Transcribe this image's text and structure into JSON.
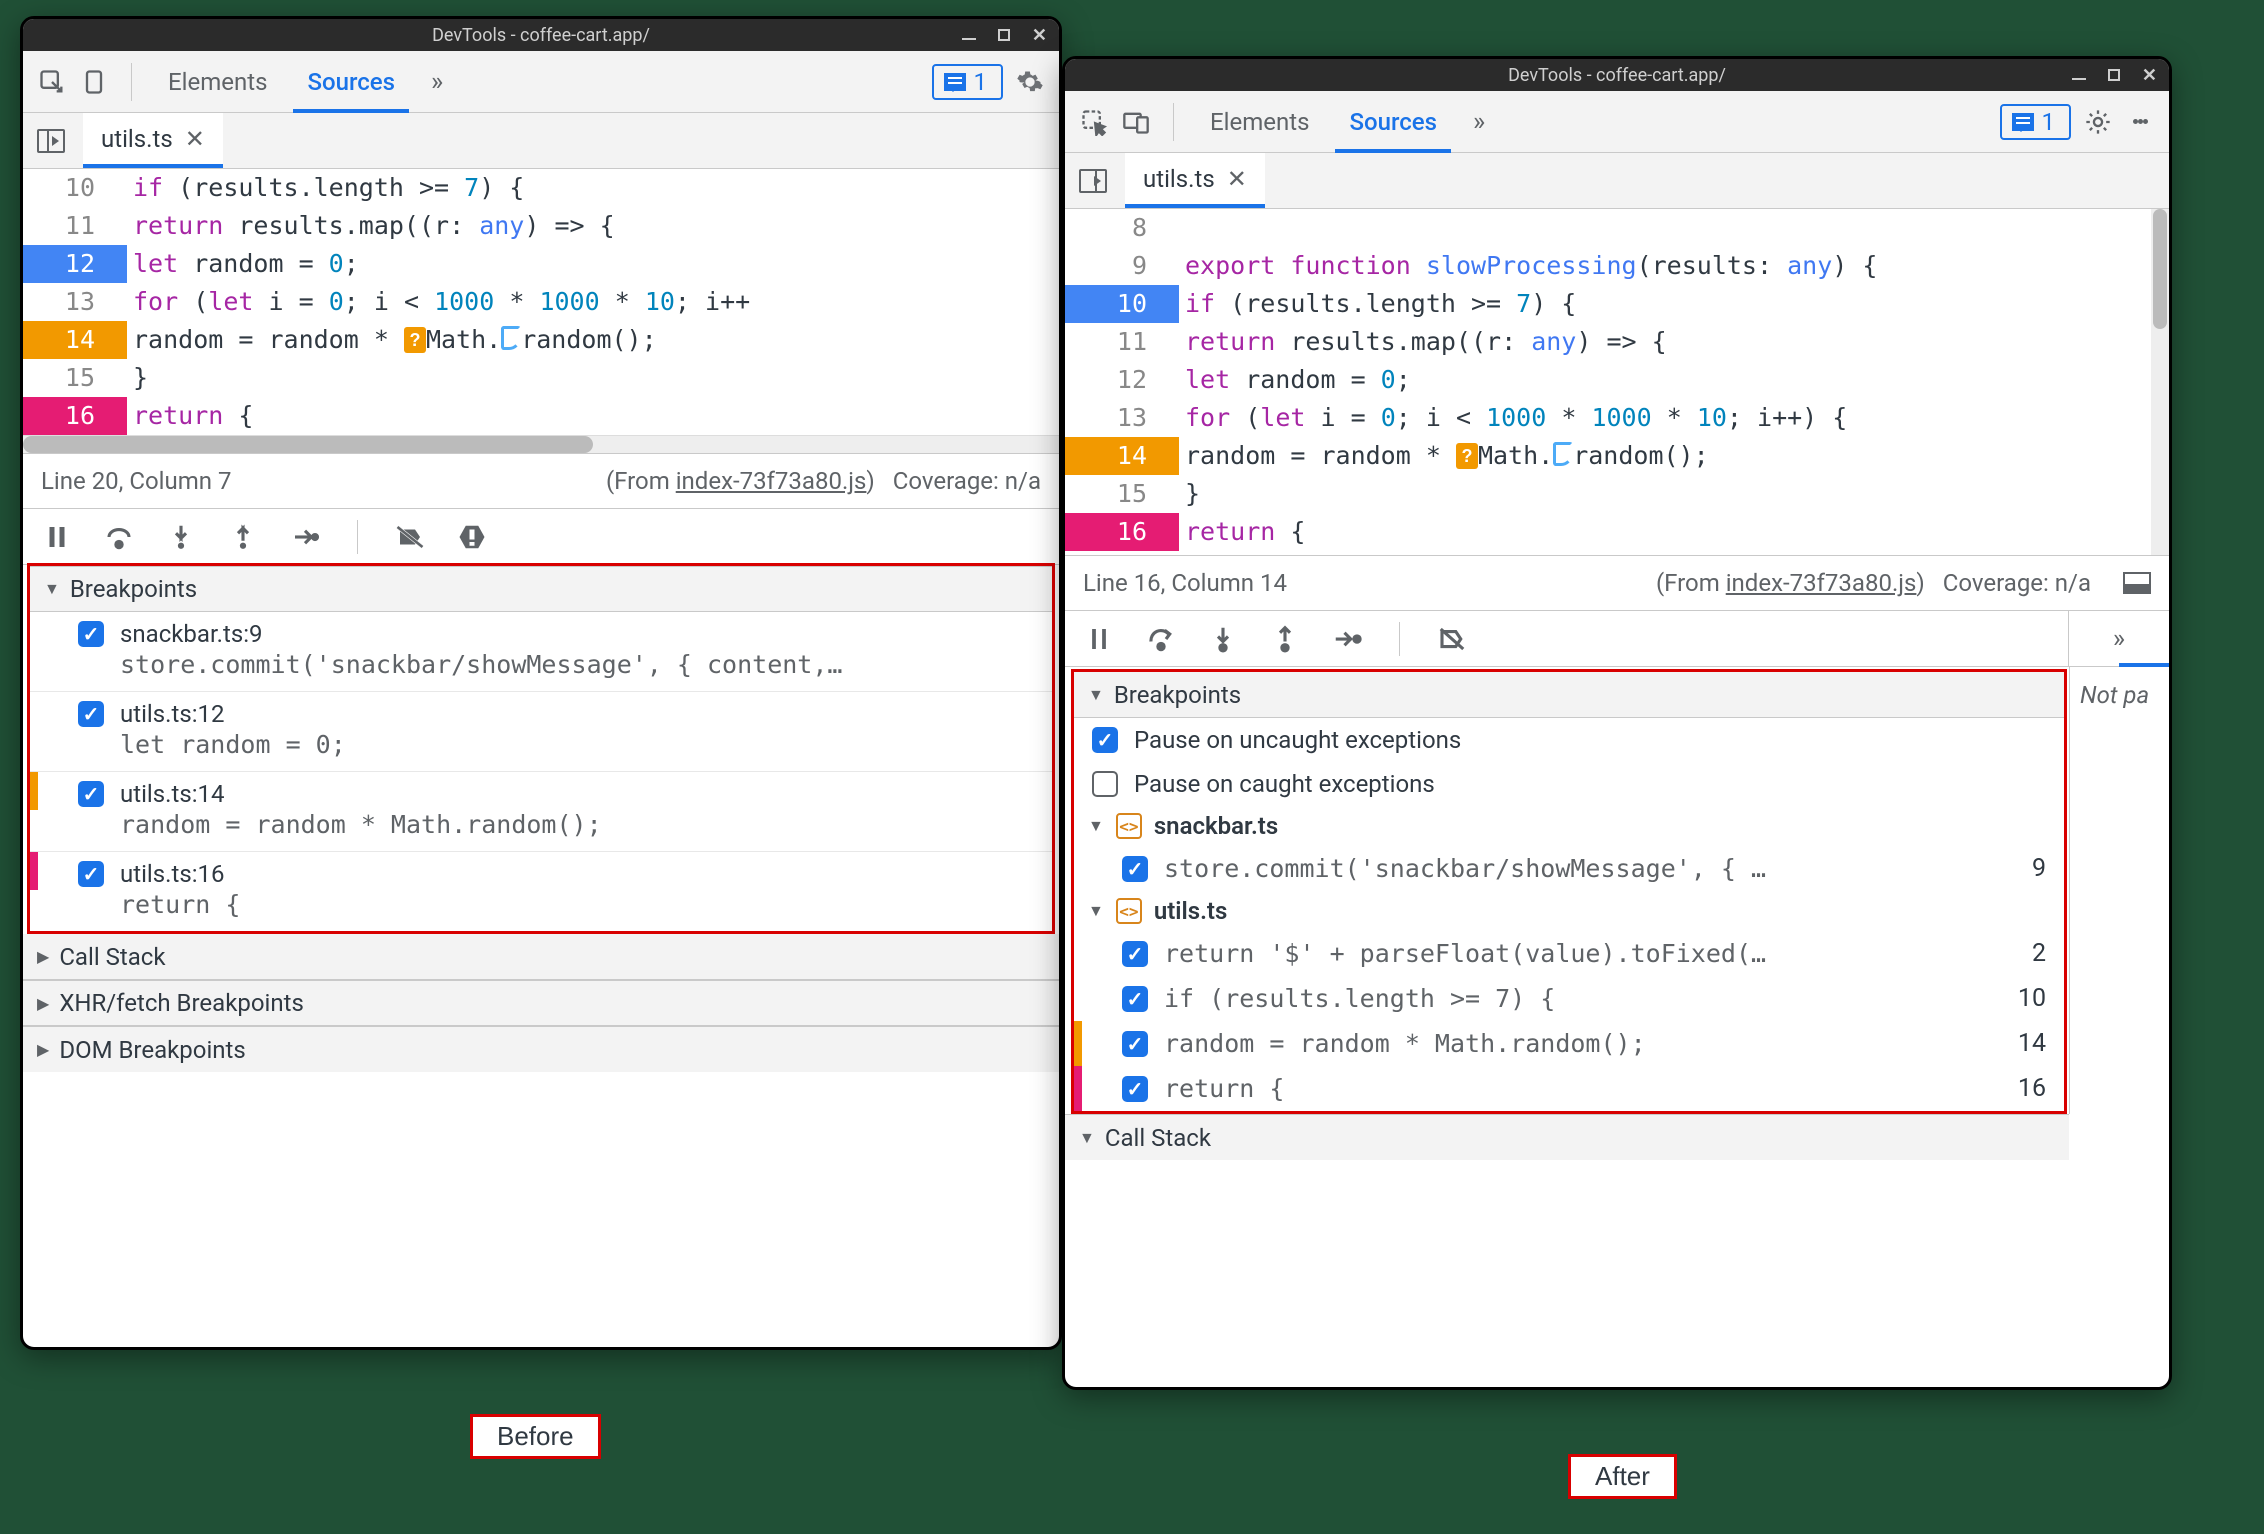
{
  "before": {
    "titlebar": "DevTools - coffee-cart.app/",
    "tabs": {
      "elements": "Elements",
      "sources": "Sources"
    },
    "msg_count": "1",
    "file_tab": "utils.ts",
    "gutter": [
      "10",
      "11",
      "12",
      "13",
      "14",
      "15",
      "16"
    ],
    "code": {
      "l10": "if (results.length >= 7) {",
      "l11": "return results.map((r: any) => {",
      "l12": "let random = 0;",
      "l13": "for (let i = 0; i < 1000 * 1000 * 10; i++",
      "l14_a": "random = random * ",
      "l14_b": "Math.",
      "l14_c": "random();",
      "l15": "}",
      "l16": "return {"
    },
    "status": {
      "pos": "Line 20, Column 7",
      "from": "(From ",
      "link": "index-73f73a80.js",
      "close": ")",
      "cov": "Coverage: n/a"
    },
    "panes": {
      "breakpoints": "Breakpoints",
      "callstack": "Call Stack",
      "xhr": "XHR/fetch Breakpoints",
      "dom": "DOM Breakpoints"
    },
    "bps": {
      "b1": {
        "label": "snackbar.ts:9",
        "snippet": "store.commit('snackbar/showMessage', { content,…"
      },
      "b2": {
        "label": "utils.ts:12",
        "snippet": "let random = 0;"
      },
      "b3": {
        "label": "utils.ts:14",
        "snippet": "random = random * Math.random();"
      },
      "b4": {
        "label": "utils.ts:16",
        "snippet": "return {"
      }
    }
  },
  "after": {
    "titlebar": "DevTools - coffee-cart.app/",
    "tabs": {
      "elements": "Elements",
      "sources": "Sources"
    },
    "msg_count": "1",
    "file_tab": "utils.ts",
    "gutter": [
      "8",
      "9",
      "10",
      "11",
      "12",
      "13",
      "14",
      "15",
      "16"
    ],
    "code": {
      "l8": "",
      "l9": "export function slowProcessing(results: any) {",
      "l10": "if (results.length >= 7) {",
      "l11": "return results.map((r: any) => {",
      "l12": "let random = 0;",
      "l13": "for (let i = 0; i < 1000 * 1000 * 10; i++) {",
      "l14_a": "random = random * ",
      "l14_b": "Math.",
      "l14_c": "random();",
      "l15": "}",
      "l16": "return {"
    },
    "status": {
      "pos": "Line 16, Column 14",
      "from": "(From ",
      "link": "index-73f73a80.js",
      "close": ")",
      "cov": "Coverage: n/a"
    },
    "panes": {
      "breakpoints": "Breakpoints",
      "pause_uncaught": "Pause on uncaught exceptions",
      "pause_caught": "Pause on caught exceptions",
      "file1": "snackbar.ts",
      "file2": "utils.ts",
      "callstack": "Call Stack"
    },
    "bps": {
      "s1": {
        "code": "store.commit('snackbar/showMessage', { …",
        "ln": "9"
      },
      "u1": {
        "code": "return '$' + parseFloat(value).toFixed(…",
        "ln": "2"
      },
      "u2": {
        "code": "if (results.length >= 7) {",
        "ln": "10"
      },
      "u3": {
        "code": "random = random * Math.random();",
        "ln": "14"
      },
      "u4": {
        "code": "return {",
        "ln": "16"
      }
    },
    "notpa": "Not pa"
  },
  "labels": {
    "before": "Before",
    "after": "After"
  }
}
